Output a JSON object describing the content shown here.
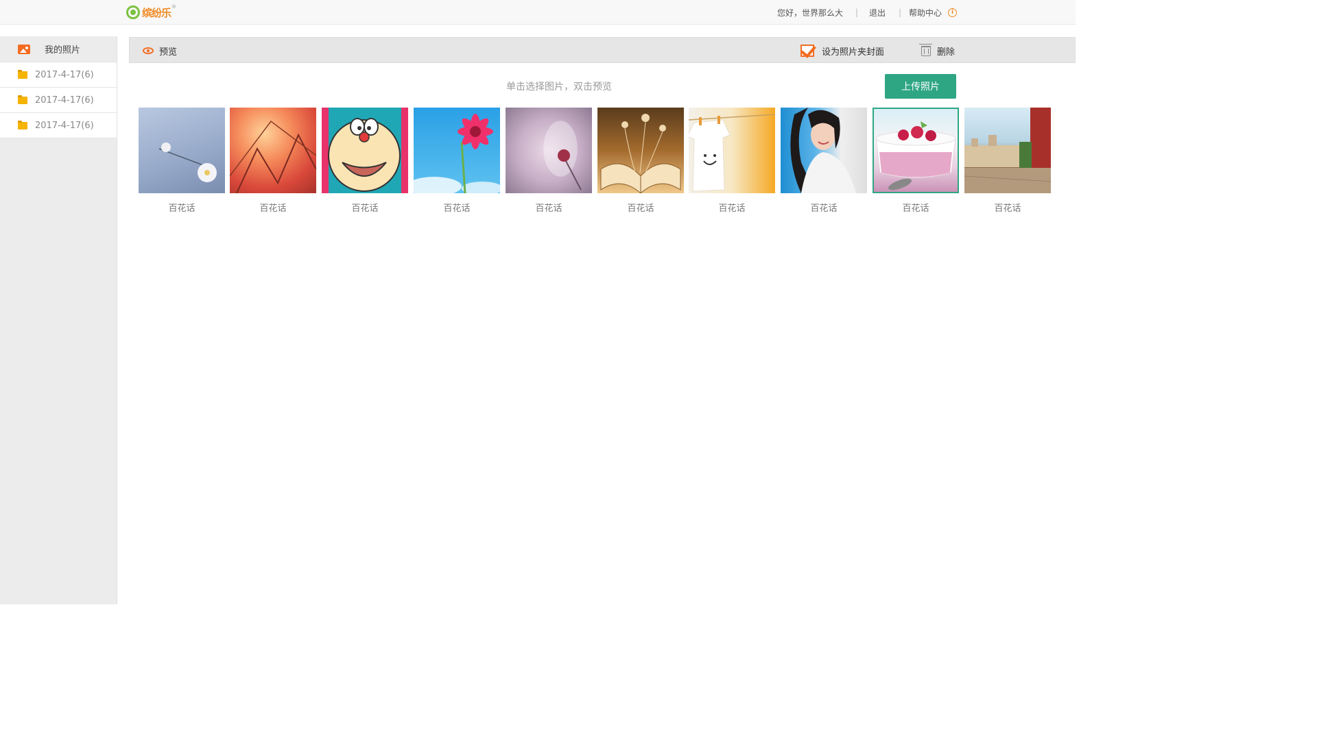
{
  "header": {
    "logo_text": "缤纷乐",
    "logo_reg": "®",
    "greeting": "您好，世界那么大",
    "separator": "|",
    "logout": "退出",
    "help": "帮助中心",
    "info_glyph": "i"
  },
  "sidebar": {
    "title": "我的照片",
    "items": [
      {
        "label": "2017-4-17(6)"
      },
      {
        "label": "2017-4-17(6)"
      },
      {
        "label": "2017-4-17(6)"
      }
    ]
  },
  "toolbar": {
    "preview": "预览",
    "set_cover": "设为照片夹封面",
    "delete": "删除"
  },
  "main": {
    "hint": "单击选择图片，双击预览",
    "upload": "上传照片",
    "photos": [
      {
        "caption": "百花话"
      },
      {
        "caption": "百花话"
      },
      {
        "caption": "百花话"
      },
      {
        "caption": "百花话"
      },
      {
        "caption": "百花话"
      },
      {
        "caption": "百花话"
      },
      {
        "caption": "百花话"
      },
      {
        "caption": "百花话"
      },
      {
        "caption": "百花话",
        "selected": true
      },
      {
        "caption": "百花话"
      }
    ]
  },
  "colors": {
    "accent": "#f36c21",
    "primary_green": "#2ea684",
    "folder": "#f5b400"
  }
}
